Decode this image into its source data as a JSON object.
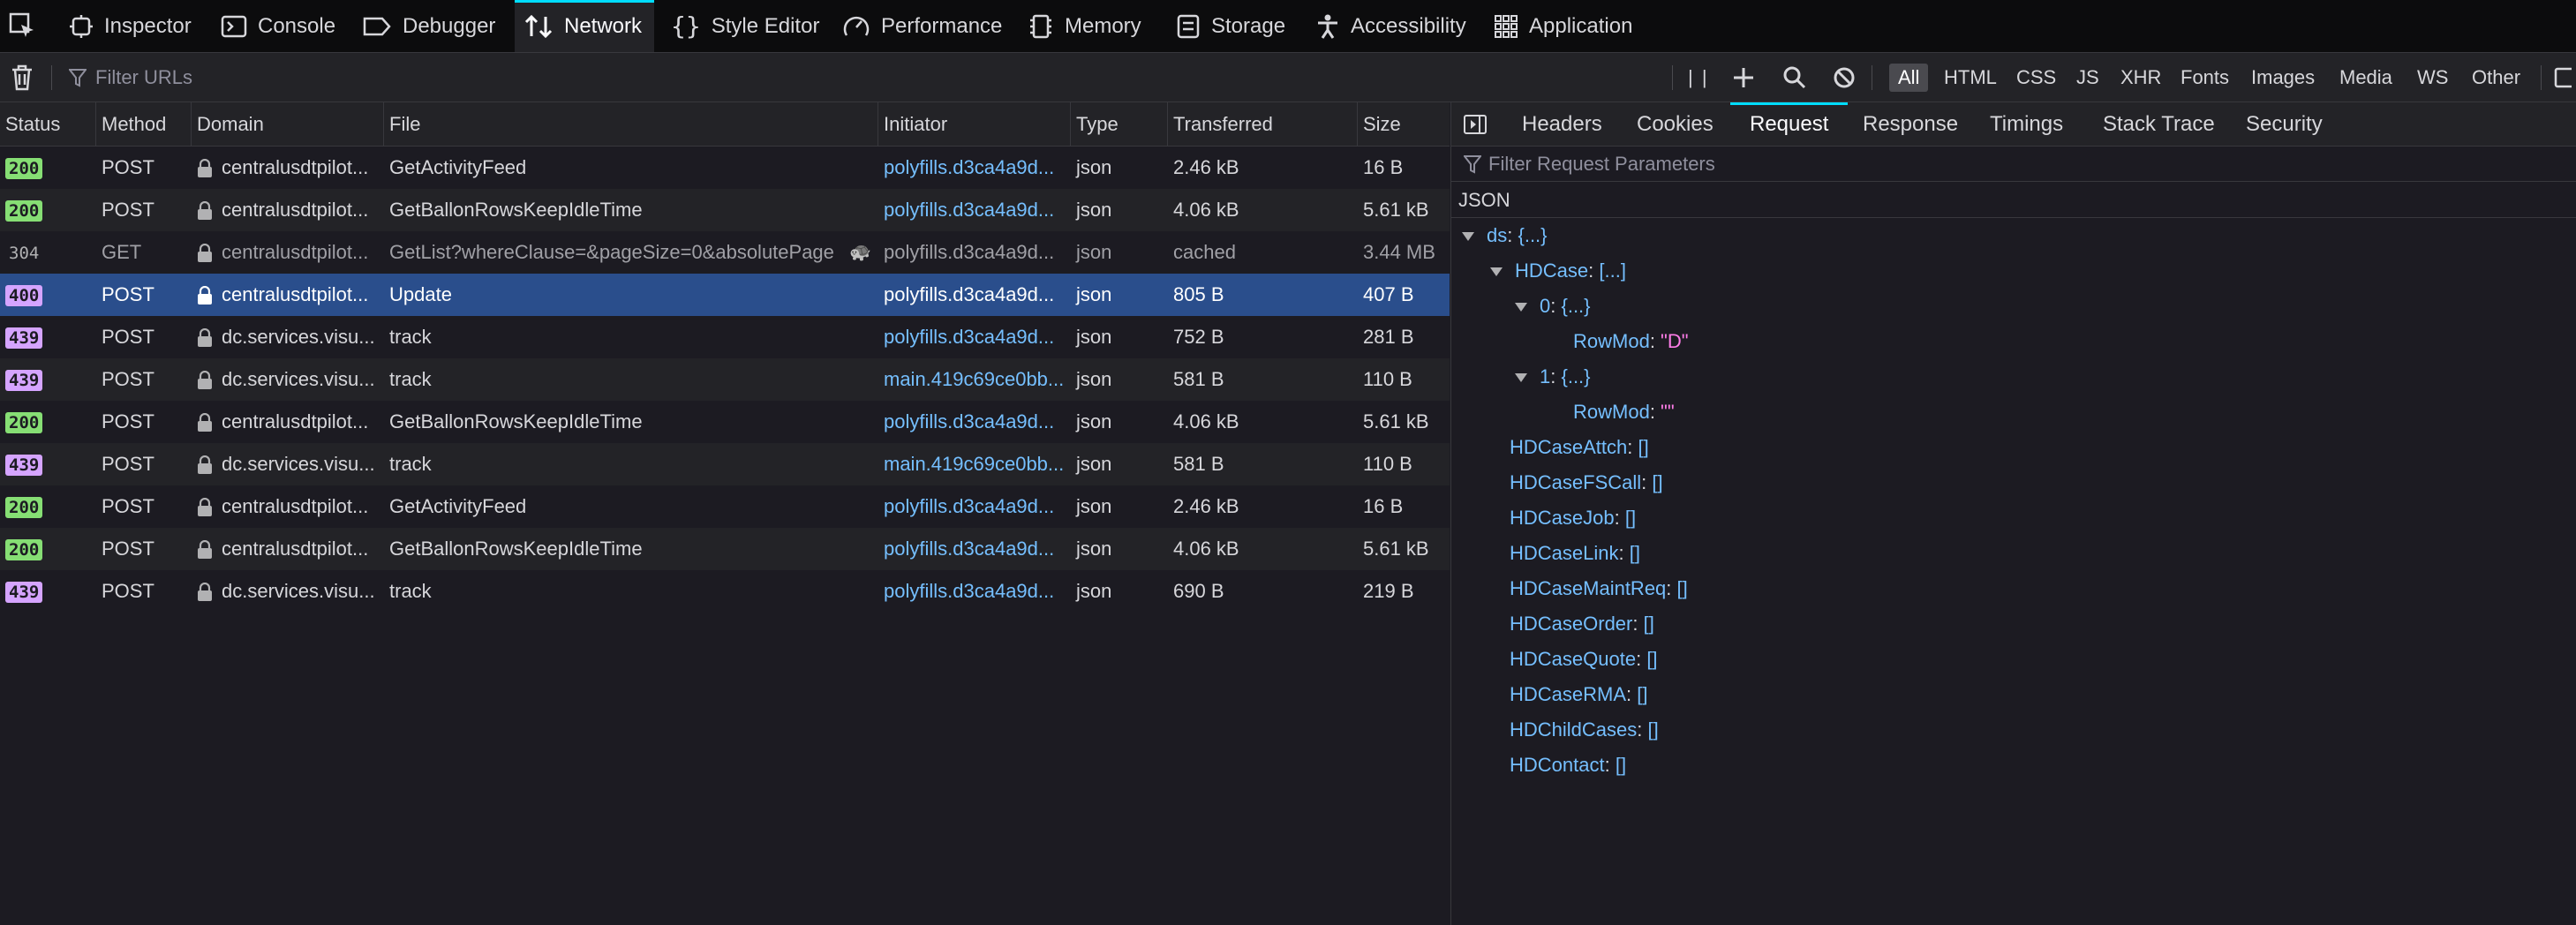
{
  "tabs": [
    {
      "label": "Inspector",
      "icon": "inspector-icon"
    },
    {
      "label": "Console",
      "icon": "console-icon"
    },
    {
      "label": "Debugger",
      "icon": "debugger-icon"
    },
    {
      "label": "Network",
      "icon": "network-icon",
      "active": true
    },
    {
      "label": "Style Editor",
      "icon": "style-editor-icon"
    },
    {
      "label": "Performance",
      "icon": "performance-icon"
    },
    {
      "label": "Memory",
      "icon": "memory-icon"
    },
    {
      "label": "Storage",
      "icon": "storage-icon"
    },
    {
      "label": "Accessibility",
      "icon": "accessibility-icon"
    },
    {
      "label": "Application",
      "icon": "application-icon"
    }
  ],
  "filter": {
    "placeholder": "Filter URLs",
    "pause_label": "| |",
    "types": [
      "All",
      "HTML",
      "CSS",
      "JS",
      "XHR",
      "Fonts",
      "Images",
      "Media",
      "WS",
      "Other"
    ],
    "active_type": "All"
  },
  "table": {
    "columns": [
      "Status",
      "Method",
      "Domain",
      "File",
      "Initiator",
      "Type",
      "Transferred",
      "Size"
    ],
    "rows": [
      {
        "status": "200",
        "method": "POST",
        "domain": "centralusdtpilot...",
        "file": "GetActivityFeed",
        "initiator": "polyfills.d3ca4a9d...",
        "type": "json",
        "transferred": "2.46 kB",
        "size": "16 B"
      },
      {
        "status": "200",
        "method": "POST",
        "domain": "centralusdtpilot...",
        "file": "GetBallonRowsKeepIdleTime",
        "initiator": "polyfills.d3ca4a9d...",
        "type": "json",
        "transferred": "4.06 kB",
        "size": "5.61 kB"
      },
      {
        "status": "304",
        "method": "GET",
        "domain": "centralusdtpilot...",
        "file": "GetList?whereClause=&pageSize=0&absolutePage",
        "initiator": "polyfills.d3ca4a9d...",
        "type": "json",
        "transferred": "cached",
        "size": "3.44 MB",
        "cached": true
      },
      {
        "status": "400",
        "method": "POST",
        "domain": "centralusdtpilot...",
        "file": "Update",
        "initiator": "polyfills.d3ca4a9d...",
        "type": "json",
        "transferred": "805 B",
        "size": "407 B",
        "selected": true
      },
      {
        "status": "439",
        "method": "POST",
        "domain": "dc.services.visu...",
        "file": "track",
        "initiator": "polyfills.d3ca4a9d...",
        "type": "json",
        "transferred": "752 B",
        "size": "281 B"
      },
      {
        "status": "439",
        "method": "POST",
        "domain": "dc.services.visu...",
        "file": "track",
        "initiator": "main.419c69ce0bb...",
        "type": "json",
        "transferred": "581 B",
        "size": "110 B"
      },
      {
        "status": "200",
        "method": "POST",
        "domain": "centralusdtpilot...",
        "file": "GetBallonRowsKeepIdleTime",
        "initiator": "polyfills.d3ca4a9d...",
        "type": "json",
        "transferred": "4.06 kB",
        "size": "5.61 kB"
      },
      {
        "status": "439",
        "method": "POST",
        "domain": "dc.services.visu...",
        "file": "track",
        "initiator": "main.419c69ce0bb...",
        "type": "json",
        "transferred": "581 B",
        "size": "110 B"
      },
      {
        "status": "200",
        "method": "POST",
        "domain": "centralusdtpilot...",
        "file": "GetActivityFeed",
        "initiator": "polyfills.d3ca4a9d...",
        "type": "json",
        "transferred": "2.46 kB",
        "size": "16 B"
      },
      {
        "status": "200",
        "method": "POST",
        "domain": "centralusdtpilot...",
        "file": "GetBallonRowsKeepIdleTime",
        "initiator": "polyfills.d3ca4a9d...",
        "type": "json",
        "transferred": "4.06 kB",
        "size": "5.61 kB"
      },
      {
        "status": "439",
        "method": "POST",
        "domain": "dc.services.visu...",
        "file": "track",
        "initiator": "polyfills.d3ca4a9d...",
        "type": "json",
        "transferred": "690 B",
        "size": "219 B"
      }
    ]
  },
  "status_colors": {
    "200": "#86de74",
    "304": "#2a2a2e",
    "400": "#d5a4ff",
    "439": "#d5a4ff"
  },
  "panel": {
    "tabs": [
      "Headers",
      "Cookies",
      "Request",
      "Response",
      "Timings",
      "Stack Trace",
      "Security"
    ],
    "active_tab": "Request",
    "filter_placeholder": "Filter Request Parameters",
    "section_label": "JSON",
    "tree": [
      {
        "depth": 0,
        "twisty": true,
        "key": "ds",
        "val": "{...}"
      },
      {
        "depth": 1,
        "twisty": true,
        "key": "HDCase",
        "val": "[...]"
      },
      {
        "depth": 2,
        "twisty": true,
        "key": "0",
        "val": "{...}"
      },
      {
        "depth": 3,
        "twisty": false,
        "key": "RowMod",
        "val": "\"D\"",
        "str": true
      },
      {
        "depth": 2,
        "twisty": true,
        "key": "1",
        "val": "{...}"
      },
      {
        "depth": 3,
        "twisty": false,
        "key": "RowMod",
        "val": "\"\"",
        "str": true
      },
      {
        "depth": 1,
        "twisty": false,
        "key": "HDCaseAttch",
        "val": "[]"
      },
      {
        "depth": 1,
        "twisty": false,
        "key": "HDCaseFSCall",
        "val": "[]"
      },
      {
        "depth": 1,
        "twisty": false,
        "key": "HDCaseJob",
        "val": "[]"
      },
      {
        "depth": 1,
        "twisty": false,
        "key": "HDCaseLink",
        "val": "[]"
      },
      {
        "depth": 1,
        "twisty": false,
        "key": "HDCaseMaintReq",
        "val": "[]"
      },
      {
        "depth": 1,
        "twisty": false,
        "key": "HDCaseOrder",
        "val": "[]"
      },
      {
        "depth": 1,
        "twisty": false,
        "key": "HDCaseQuote",
        "val": "[]"
      },
      {
        "depth": 1,
        "twisty": false,
        "key": "HDCaseRMA",
        "val": "[]"
      },
      {
        "depth": 1,
        "twisty": false,
        "key": "HDChildCases",
        "val": "[]"
      },
      {
        "depth": 1,
        "twisty": false,
        "key": "HDContact",
        "val": "[]"
      }
    ]
  }
}
